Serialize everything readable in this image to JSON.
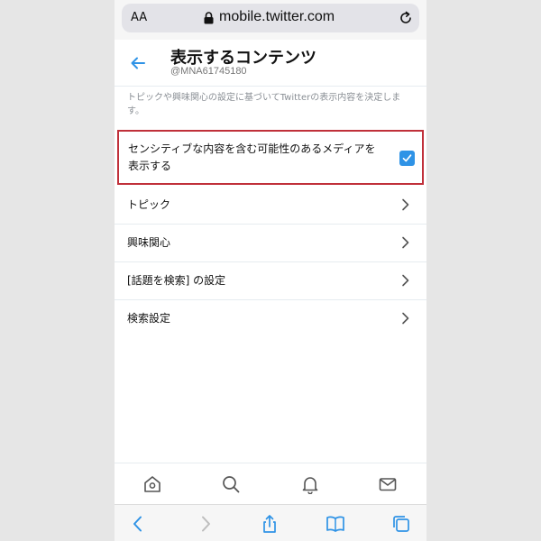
{
  "browser": {
    "text_size_label": "AA",
    "url": "mobile.twitter.com",
    "icons": [
      "lock-icon",
      "reload-icon"
    ]
  },
  "header": {
    "title": "表示するコンテンツ",
    "handle": "@MNA61745180",
    "back_icon": "back-arrow-icon"
  },
  "description": "トピックや興味関心の設定に基づいてTwitterの表示内容を決定します。",
  "sensitive_media": {
    "label": "センシティブな内容を含む可能性のあるメディアを表示する",
    "checked": true,
    "highlight_color": "#c0303a"
  },
  "settings_items": [
    {
      "label": "トピック"
    },
    {
      "label": "興味関心"
    },
    {
      "label": "[話題を検索] の設定"
    },
    {
      "label": "検索設定"
    }
  ],
  "tabbar": {
    "items": [
      "home-icon",
      "search-icon",
      "notifications-icon",
      "messages-icon"
    ]
  },
  "safari_toolbar": {
    "items": [
      "back-icon",
      "forward-icon",
      "share-icon",
      "bookmarks-icon",
      "tabs-icon"
    ]
  },
  "colors": {
    "accent": "#2f93e6",
    "icon_gray": "#555555"
  }
}
